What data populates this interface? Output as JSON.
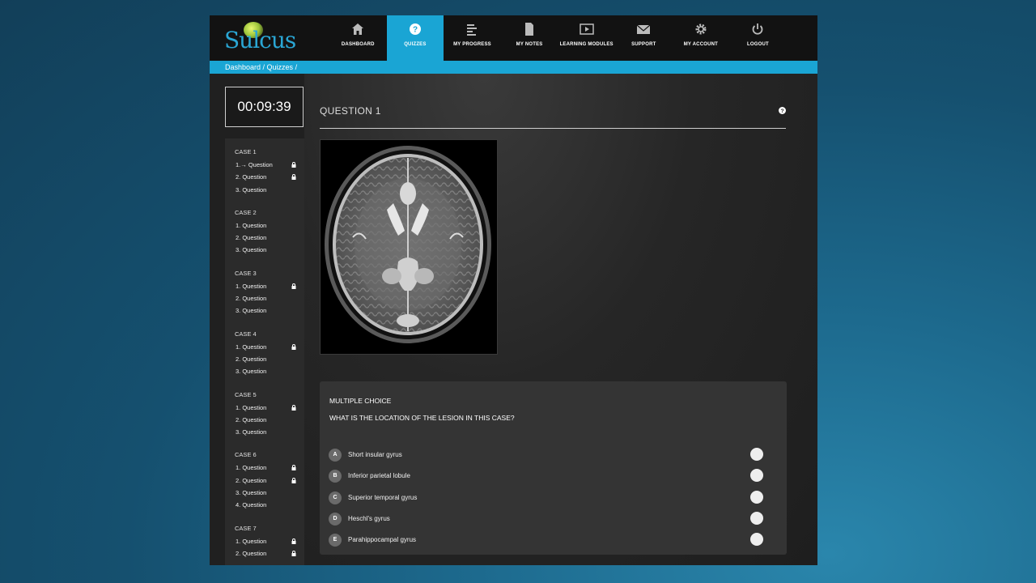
{
  "app": {
    "logo_text": "Sulcus"
  },
  "nav": [
    {
      "label": "DASHBOARD",
      "icon": "home-icon",
      "active": false
    },
    {
      "label": "QUIZZES",
      "icon": "question-circle-icon",
      "active": true
    },
    {
      "label": "MY PROGRESS",
      "icon": "bar-chart-icon",
      "active": false
    },
    {
      "label": "MY NOTES",
      "icon": "document-icon",
      "active": false
    },
    {
      "label": "LEARNING MODULES",
      "icon": "play-icon",
      "active": false
    },
    {
      "label": "SUPPORT",
      "icon": "envelope-icon",
      "active": false
    },
    {
      "label": "MY ACCOUNT",
      "icon": "gear-icon",
      "active": false
    },
    {
      "label": "LOGOUT",
      "icon": "power-icon",
      "active": false
    }
  ],
  "breadcrumb": {
    "dashboard": "Dashboard",
    "sep1": " / ",
    "quizzes": "Quizzes",
    "sep2": " /"
  },
  "timer": "00:09:39",
  "cases": [
    {
      "title": "CASE 1",
      "questions": [
        {
          "label": "1.→ Question",
          "locked": true,
          "current": true
        },
        {
          "label": "2. Question",
          "locked": true
        },
        {
          "label": "3. Question",
          "locked": false
        }
      ]
    },
    {
      "title": "CASE 2",
      "questions": [
        {
          "label": "1. Question",
          "locked": false
        },
        {
          "label": "2. Question",
          "locked": false
        },
        {
          "label": "3. Question",
          "locked": false
        }
      ]
    },
    {
      "title": "CASE 3",
      "questions": [
        {
          "label": "1. Question",
          "locked": true
        },
        {
          "label": "2. Question",
          "locked": false
        },
        {
          "label": "3. Question",
          "locked": false
        }
      ]
    },
    {
      "title": "CASE 4",
      "questions": [
        {
          "label": "1. Question",
          "locked": true
        },
        {
          "label": "2. Question",
          "locked": false
        },
        {
          "label": "3. Question",
          "locked": false
        }
      ]
    },
    {
      "title": "CASE 5",
      "questions": [
        {
          "label": "1. Question",
          "locked": true
        },
        {
          "label": "2. Question",
          "locked": false
        },
        {
          "label": "3. Question",
          "locked": false
        }
      ]
    },
    {
      "title": "CASE 6",
      "questions": [
        {
          "label": "1. Question",
          "locked": true
        },
        {
          "label": "2. Question",
          "locked": true
        },
        {
          "label": "3. Question",
          "locked": false
        },
        {
          "label": "4. Question",
          "locked": false
        }
      ]
    },
    {
      "title": "CASE 7",
      "questions": [
        {
          "label": "1. Question",
          "locked": true
        },
        {
          "label": "2. Question",
          "locked": true
        }
      ]
    }
  ],
  "question": {
    "title": "QUESTION 1",
    "type_label": "MULTIPLE CHOICE",
    "prompt": "WHAT IS THE LOCATION OF THE LESION IN THIS CASE?",
    "options": [
      {
        "letter": "A",
        "text": "Short insular gyrus"
      },
      {
        "letter": "B",
        "text": "Inferior parietal lobule"
      },
      {
        "letter": "C",
        "text": "Superior temporal gyrus"
      },
      {
        "letter": "D",
        "text": "Heschl's gyrus"
      },
      {
        "letter": "E",
        "text": "Parahippocampal gyrus"
      }
    ]
  },
  "colors": {
    "accent": "#1aa5d4",
    "topbar": "#121212",
    "panel": "#343434"
  }
}
